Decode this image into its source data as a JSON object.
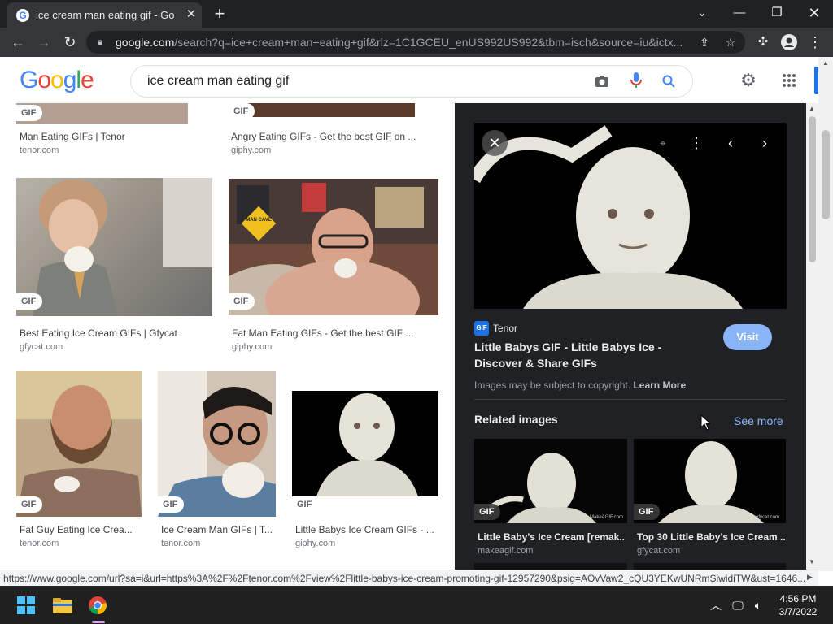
{
  "browser": {
    "tab_title": "ice cream man eating gif - Google",
    "url_host": "google.com",
    "url_path": "/search?q=ice+cream+man+eating+gif&rlz=1C1GCEU_enUS992US992&tbm=isch&source=iu&ictx...",
    "status_url": "https://www.google.com/url?sa=i&url=https%3A%2F%2Ftenor.com%2Fview%2Flittle-babys-ice-cream-promoting-gif-12957290&psig=AOvVaw2_cQU3YEKwUNRmSiwidiTW&ust=1646..."
  },
  "google": {
    "logo_letters": [
      "G",
      "o",
      "o",
      "g",
      "l",
      "e"
    ],
    "logo_colors": [
      "#4285f4",
      "#ea4335",
      "#fbbc05",
      "#4285f4",
      "#34a853",
      "#ea4335"
    ],
    "query": "ice cream man eating gif"
  },
  "results": {
    "top_row": [
      {
        "title": "Man Eating GIFs | Tenor",
        "source": "tenor.com",
        "badge": "GIF"
      },
      {
        "title": "Angry Eating GIFs - Get the best GIF on ...",
        "source": "giphy.com",
        "badge": "GIF"
      }
    ],
    "row2": [
      {
        "title": "Best Eating Ice Cream GIFs | Gfycat",
        "source": "gfycat.com",
        "badge": "GIF"
      },
      {
        "title": "Fat Man Eating GIFs - Get the best GIF ...",
        "source": "giphy.com",
        "badge": "GIF"
      }
    ],
    "row3": [
      {
        "title": "Fat Guy Eating Ice Crea...",
        "source": "tenor.com",
        "badge": "GIF"
      },
      {
        "title": "Ice Cream Man GIFs | T...",
        "source": "tenor.com",
        "badge": "GIF"
      },
      {
        "title": "Little Babys Ice Cream GIFs - ...",
        "source": "giphy.com",
        "badge": "GIF"
      }
    ],
    "sign_text": "MAN CAVE"
  },
  "panel": {
    "source_icon_label": "GIF",
    "source_name": "Tenor",
    "title": "Little Babys GIF - Little Babys Ice - Discover & Share GIFs",
    "visit_label": "Visit",
    "copyright_text": "Images may be subject to copyright.",
    "learn_more": "Learn More",
    "related_title": "Related images",
    "see_more": "See more",
    "related": [
      {
        "caption": "Little Baby's Ice Cream [remak...",
        "source": "makeagif.com",
        "badge": "GIF",
        "watermark": "MakeAGIF.com"
      },
      {
        "caption": "Top 30 Little Baby's Ice Cream ...",
        "source": "gfycat.com",
        "badge": "GIF",
        "watermark": "gfycat.com"
      }
    ]
  },
  "taskbar": {
    "time": "4:56 PM",
    "date": "3/7/2022"
  }
}
